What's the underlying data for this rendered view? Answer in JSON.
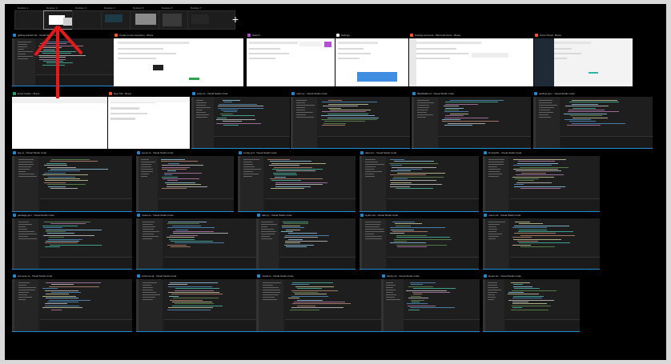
{
  "desktops": [
    {
      "label": "Desktop 1"
    },
    {
      "label": "Desktop 2"
    },
    {
      "label": "Desktop 3"
    },
    {
      "label": "Desktop 4"
    },
    {
      "label": "Desktop 5"
    },
    {
      "label": "Desktop 6"
    },
    {
      "label": "Desktop 7"
    }
  ],
  "new_desktop_label": "+",
  "windows": [
    {
      "title": "getting-started.md - Visual Studio Code",
      "app": "vscode"
    },
    {
      "title": "Create a new repository - Brave",
      "app": "brave"
    },
    {
      "title": "Search",
      "app": "search"
    },
    {
      "title": "Settings",
      "app": "settings"
    },
    {
      "title": "Storage accounts - Microsoft Azure - Brave",
      "app": "brave"
    },
    {
      "title": "Azure Portal - Brave",
      "app": "brave"
    },
    {
      "title": "Excel Online - Brave",
      "app": "excel"
    },
    {
      "title": "New Tab - Brave",
      "app": "brave"
    },
    {
      "title": "index.ts - Visual Studio Code",
      "app": "vscode"
    },
    {
      "title": "main.py - Visual Studio Code",
      "app": "vscode"
    },
    {
      "title": "README.md - Visual Studio Code",
      "app": "vscode"
    },
    {
      "title": "settings.json - Visual Studio Code",
      "app": "vscode"
    },
    {
      "title": "app.js - Visual Studio Code",
      "app": "vscode"
    },
    {
      "title": "server.ts - Visual Studio Code",
      "app": "vscode"
    },
    {
      "title": "config.yml - Visual Studio Code",
      "app": "vscode"
    },
    {
      "title": "data.csv - Visual Studio Code",
      "app": "vscode"
    },
    {
      "title": "Dockerfile - Visual Studio Code",
      "app": "vscode"
    },
    {
      "title": "package.json - Visual Studio Code",
      "app": "vscode"
    },
    {
      "title": "routes.ts - Visual Studio Code",
      "app": "vscode"
    },
    {
      "title": "utils.py - Visual Studio Code",
      "app": "vscode"
    },
    {
      "title": "styles.css - Visual Studio Code",
      "app": "vscode"
    },
    {
      "title": "notes.md - Visual Studio Code",
      "app": "vscode"
    },
    {
      "title": "test.spec.ts - Visual Studio Code",
      "app": "vscode"
    },
    {
      "title": "schema.sql - Visual Studio Code",
      "app": "vscode"
    },
    {
      "title": "model.ts - Visual Studio Code",
      "app": "vscode"
    },
    {
      "title": "deploy.sh - Visual Studio Code",
      "app": "vscode"
    },
    {
      "title": "layout.tsx - Visual Studio Code",
      "app": "vscode"
    }
  ],
  "colors": {
    "annotation_arrow": "#e3191b",
    "vscode_accent": "#1f8ad2"
  }
}
